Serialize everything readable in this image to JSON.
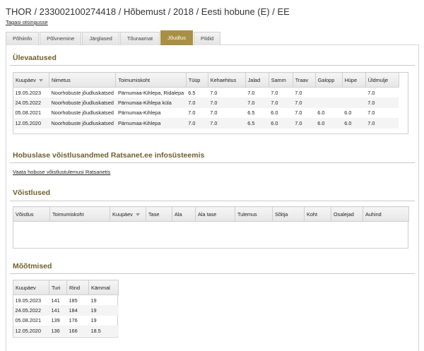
{
  "header": {
    "title": "THOR / 233002100274418 / Hõbemust / 2018 / Eesti hobune (E) / EE",
    "back_link": "Tagasi otsingusse"
  },
  "tabs": [
    {
      "label": "Põhiinfo",
      "active": false
    },
    {
      "label": "Põlvnemine",
      "active": false
    },
    {
      "label": "Järglased",
      "active": false
    },
    {
      "label": "Tõuraamat",
      "active": false
    },
    {
      "label": "Jõudlus",
      "active": true
    },
    {
      "label": "Pildid",
      "active": false
    }
  ],
  "overview": {
    "title": "Ülevaatused",
    "columns": [
      "Kuupäev",
      "Nimetus",
      "Toimumiskoht",
      "Tüüp",
      "Kehaehitus",
      "Jalad",
      "Samm",
      "Traav",
      "Galopp",
      "Hüpe",
      "Üldmulje"
    ],
    "rows": [
      [
        "19.05.2023",
        "Noorhobuste jõudluskatsed",
        "Pärnumaa-Kihlepa, Ridalepa",
        "6.5",
        "7.0",
        "7.0",
        "7.0",
        "7.0",
        "",
        "",
        "7.0"
      ],
      [
        "24.05.2022",
        "Noorhobuste jõudluskatsed",
        "Pärnumaa-Kihlepa küla",
        "7.0",
        "7.0",
        "7.0",
        "7.0",
        "7.0",
        "",
        "",
        "7.0"
      ],
      [
        "05.08.2021",
        "Noorhobuste jõudluskatsed",
        "Pärnumaa-Kihlepa",
        "7.0",
        "7.0",
        "6.5",
        "6.0",
        "7.0",
        "6.0",
        "6.0",
        "7.0"
      ],
      [
        "12.05.2020",
        "Noorhobuste jõudluskatsed",
        "Pärnumaa-Kihlepa",
        "7.0",
        "7.0",
        "6.5",
        "6.0",
        "7.0",
        "6.0",
        "6.0",
        "7.0"
      ]
    ]
  },
  "ratsanet": {
    "title": "Hobuslase võistlusandmed Ratsanet.ee infosüsteemis",
    "link": "Vaata hobuse võistlustulemusi Ratsanetis"
  },
  "competitions": {
    "title": "Võistlused",
    "columns": [
      "Võistlus",
      "Toimumiskoht",
      "Kuupäev",
      "Tase",
      "Ala",
      "Ala tase",
      "Tulemus",
      "Sõitja",
      "Koht",
      "Osalejad",
      "Auhind"
    ],
    "rows": []
  },
  "measurements": {
    "title": "Mõõtmised",
    "columns": [
      "Kuupäev",
      "Turi",
      "Rind",
      "Kämmal"
    ],
    "rows": [
      [
        "19.05.2023",
        "141",
        "185",
        "19"
      ],
      [
        "24.05.2022",
        "141",
        "184",
        "19"
      ],
      [
        "05.08.2021",
        "139",
        "176",
        "19"
      ],
      [
        "12.05.2020",
        "136",
        "166",
        "18.5"
      ]
    ]
  },
  "colors": {
    "accent": "#a88f45",
    "section_title": "#6f5f2e"
  }
}
